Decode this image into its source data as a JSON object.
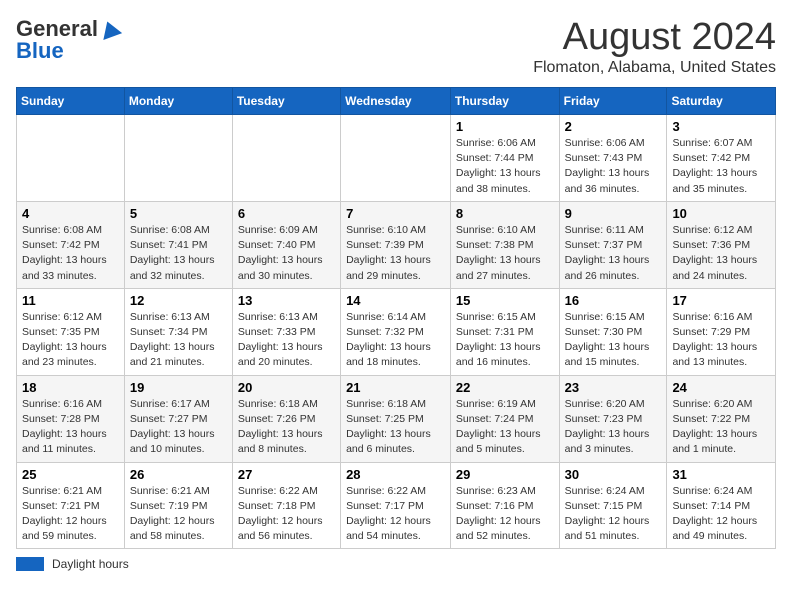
{
  "header": {
    "logo_general": "General",
    "logo_blue": "Blue",
    "title": "August 2024",
    "subtitle": "Flomaton, Alabama, United States"
  },
  "days_of_week": [
    "Sunday",
    "Monday",
    "Tuesday",
    "Wednesday",
    "Thursday",
    "Friday",
    "Saturday"
  ],
  "weeks": [
    [
      {
        "day": "",
        "info": ""
      },
      {
        "day": "",
        "info": ""
      },
      {
        "day": "",
        "info": ""
      },
      {
        "day": "",
        "info": ""
      },
      {
        "day": "1",
        "info": "Sunrise: 6:06 AM\nSunset: 7:44 PM\nDaylight: 13 hours\nand 38 minutes."
      },
      {
        "day": "2",
        "info": "Sunrise: 6:06 AM\nSunset: 7:43 PM\nDaylight: 13 hours\nand 36 minutes."
      },
      {
        "day": "3",
        "info": "Sunrise: 6:07 AM\nSunset: 7:42 PM\nDaylight: 13 hours\nand 35 minutes."
      }
    ],
    [
      {
        "day": "4",
        "info": "Sunrise: 6:08 AM\nSunset: 7:42 PM\nDaylight: 13 hours\nand 33 minutes."
      },
      {
        "day": "5",
        "info": "Sunrise: 6:08 AM\nSunset: 7:41 PM\nDaylight: 13 hours\nand 32 minutes."
      },
      {
        "day": "6",
        "info": "Sunrise: 6:09 AM\nSunset: 7:40 PM\nDaylight: 13 hours\nand 30 minutes."
      },
      {
        "day": "7",
        "info": "Sunrise: 6:10 AM\nSunset: 7:39 PM\nDaylight: 13 hours\nand 29 minutes."
      },
      {
        "day": "8",
        "info": "Sunrise: 6:10 AM\nSunset: 7:38 PM\nDaylight: 13 hours\nand 27 minutes."
      },
      {
        "day": "9",
        "info": "Sunrise: 6:11 AM\nSunset: 7:37 PM\nDaylight: 13 hours\nand 26 minutes."
      },
      {
        "day": "10",
        "info": "Sunrise: 6:12 AM\nSunset: 7:36 PM\nDaylight: 13 hours\nand 24 minutes."
      }
    ],
    [
      {
        "day": "11",
        "info": "Sunrise: 6:12 AM\nSunset: 7:35 PM\nDaylight: 13 hours\nand 23 minutes."
      },
      {
        "day": "12",
        "info": "Sunrise: 6:13 AM\nSunset: 7:34 PM\nDaylight: 13 hours\nand 21 minutes."
      },
      {
        "day": "13",
        "info": "Sunrise: 6:13 AM\nSunset: 7:33 PM\nDaylight: 13 hours\nand 20 minutes."
      },
      {
        "day": "14",
        "info": "Sunrise: 6:14 AM\nSunset: 7:32 PM\nDaylight: 13 hours\nand 18 minutes."
      },
      {
        "day": "15",
        "info": "Sunrise: 6:15 AM\nSunset: 7:31 PM\nDaylight: 13 hours\nand 16 minutes."
      },
      {
        "day": "16",
        "info": "Sunrise: 6:15 AM\nSunset: 7:30 PM\nDaylight: 13 hours\nand 15 minutes."
      },
      {
        "day": "17",
        "info": "Sunrise: 6:16 AM\nSunset: 7:29 PM\nDaylight: 13 hours\nand 13 minutes."
      }
    ],
    [
      {
        "day": "18",
        "info": "Sunrise: 6:16 AM\nSunset: 7:28 PM\nDaylight: 13 hours\nand 11 minutes."
      },
      {
        "day": "19",
        "info": "Sunrise: 6:17 AM\nSunset: 7:27 PM\nDaylight: 13 hours\nand 10 minutes."
      },
      {
        "day": "20",
        "info": "Sunrise: 6:18 AM\nSunset: 7:26 PM\nDaylight: 13 hours\nand 8 minutes."
      },
      {
        "day": "21",
        "info": "Sunrise: 6:18 AM\nSunset: 7:25 PM\nDaylight: 13 hours\nand 6 minutes."
      },
      {
        "day": "22",
        "info": "Sunrise: 6:19 AM\nSunset: 7:24 PM\nDaylight: 13 hours\nand 5 minutes."
      },
      {
        "day": "23",
        "info": "Sunrise: 6:20 AM\nSunset: 7:23 PM\nDaylight: 13 hours\nand 3 minutes."
      },
      {
        "day": "24",
        "info": "Sunrise: 6:20 AM\nSunset: 7:22 PM\nDaylight: 13 hours\nand 1 minute."
      }
    ],
    [
      {
        "day": "25",
        "info": "Sunrise: 6:21 AM\nSunset: 7:21 PM\nDaylight: 12 hours\nand 59 minutes."
      },
      {
        "day": "26",
        "info": "Sunrise: 6:21 AM\nSunset: 7:19 PM\nDaylight: 12 hours\nand 58 minutes."
      },
      {
        "day": "27",
        "info": "Sunrise: 6:22 AM\nSunset: 7:18 PM\nDaylight: 12 hours\nand 56 minutes."
      },
      {
        "day": "28",
        "info": "Sunrise: 6:22 AM\nSunset: 7:17 PM\nDaylight: 12 hours\nand 54 minutes."
      },
      {
        "day": "29",
        "info": "Sunrise: 6:23 AM\nSunset: 7:16 PM\nDaylight: 12 hours\nand 52 minutes."
      },
      {
        "day": "30",
        "info": "Sunrise: 6:24 AM\nSunset: 7:15 PM\nDaylight: 12 hours\nand 51 minutes."
      },
      {
        "day": "31",
        "info": "Sunrise: 6:24 AM\nSunset: 7:14 PM\nDaylight: 12 hours\nand 49 minutes."
      }
    ]
  ],
  "legend": {
    "label": "Daylight hours"
  }
}
